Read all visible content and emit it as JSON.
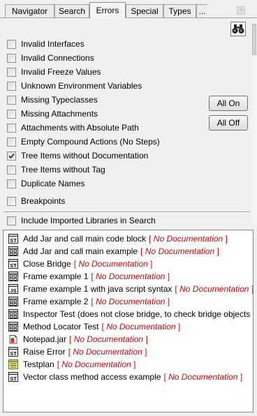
{
  "tabs": [
    {
      "label": "Navigator"
    },
    {
      "label": "Search"
    },
    {
      "label": "Errors"
    },
    {
      "label": "Special"
    },
    {
      "label": "Types"
    },
    {
      "label": "..."
    }
  ],
  "active_tab": "Errors",
  "checks": [
    {
      "label": "Invalid Interfaces",
      "checked": false
    },
    {
      "label": "Invalid Connections",
      "checked": false
    },
    {
      "label": "Invalid Freeze Values",
      "checked": false
    },
    {
      "label": "Unknown Environment Variables",
      "checked": false
    },
    {
      "label": "Missing Typeclasses",
      "checked": false
    },
    {
      "label": "Missing Attachments",
      "checked": false
    },
    {
      "label": "Attachments with Absolute Path",
      "checked": false
    },
    {
      "label": "Empty Compound Actions (No Steps)",
      "checked": false
    },
    {
      "label": "Tree Items without Documentation",
      "checked": true
    },
    {
      "label": "Tree Items without Tag",
      "checked": false
    },
    {
      "label": "Duplicate Names",
      "checked": false
    },
    {
      "label": "Breakpoints",
      "checked": false
    },
    {
      "label": "Include Imported Libraries in Search",
      "checked": false
    }
  ],
  "buttons": {
    "all_on": "All On",
    "all_off": "All Off"
  },
  "results": [
    {
      "icon": "st-icon",
      "name": "Add Jar and call main code block",
      "tag": "No Documentation"
    },
    {
      "icon": "grid-icon",
      "name": "Add Jar and call main example",
      "tag": "No Documentation"
    },
    {
      "icon": "st-icon",
      "name": "Close Bridge",
      "tag": "No Documentation"
    },
    {
      "icon": "grid-icon",
      "name": "Frame example 1",
      "tag": "No Documentation"
    },
    {
      "icon": "js-icon",
      "name": "Frame example 1 with java script syntax",
      "tag": "No Documentation"
    },
    {
      "icon": "grid-icon",
      "name": "Frame example 2",
      "tag": "No Documentation"
    },
    {
      "icon": "grid-icon",
      "name": "Inspector Test (does not close bridge, to check bridge objects",
      "tag": ""
    },
    {
      "icon": "grid-icon",
      "name": "Method Locator Test",
      "tag": "No Documentation"
    },
    {
      "icon": "jar-icon",
      "name": "Notepad.jar",
      "tag": "No Documentation"
    },
    {
      "icon": "st-icon",
      "name": "Raise Error",
      "tag": "No Documentation"
    },
    {
      "icon": "testplan-icon",
      "name": "Testplan",
      "tag": "No Documentation"
    },
    {
      "icon": "st-icon",
      "name": "Vector class method access example",
      "tag": "No Documentation"
    }
  ],
  "colors": {
    "error_tag": "#e00000",
    "list_bg": "#ffffff"
  }
}
